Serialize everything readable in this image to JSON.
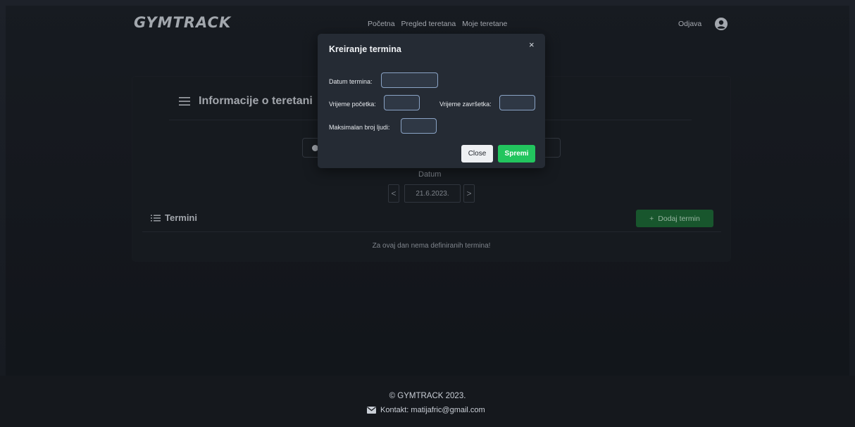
{
  "header": {
    "logo": "GYMTRACK",
    "nav": [
      {
        "label": "Početna"
      },
      {
        "label": "Pregled teretana"
      },
      {
        "label": "Moje teretane"
      }
    ],
    "logout_label": "Odjava",
    "user_icon": "user-circle-icon"
  },
  "card": {
    "title": "Informacije o teretani",
    "title_icon": "hamburger-icon",
    "date_label": "Datum",
    "date_value": "21.6.2023.",
    "prev_symbol": "<",
    "next_symbol": ">",
    "termini_label": "Termini",
    "add_button_label": "Dodaj termin",
    "add_button_symbol": "+",
    "empty_message": "Za ovaj dan nema definiranih termina!"
  },
  "modal": {
    "title": "Kreiranje termina",
    "close_symbol": "×",
    "date_label": "Datum termina:",
    "start_label": "Vrijeme početka:",
    "end_label": "Vrijeme završetka:",
    "max_people_label": "Maksimalan broj ljudi:",
    "close_button": "Close",
    "save_button": "Spremi"
  },
  "footer": {
    "copyright": "© GYMTRACK 2023.",
    "contact": "Kontakt: matijafric@gmail.com"
  },
  "colors": {
    "accent_green": "#22c55e",
    "dark_green": "#1e6a38",
    "background": "#1d2129",
    "modal_bg": "#252b34"
  }
}
